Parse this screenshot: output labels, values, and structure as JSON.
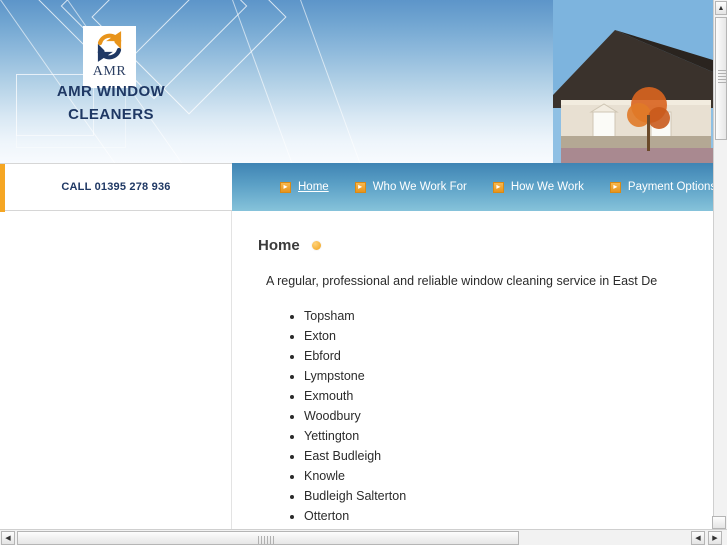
{
  "header": {
    "logo_word": "AMR",
    "brand_line1": "AMR WINDOW",
    "brand_line2": "CLEANERS",
    "logo_icon": "recycle-arrows-icon",
    "photo_alt": "house-photo"
  },
  "contact": {
    "call_text": "CALL 01395 278 936"
  },
  "nav": {
    "items": [
      {
        "label": "Home",
        "active": true
      },
      {
        "label": "Who We Work For",
        "active": false
      },
      {
        "label": "How We Work",
        "active": false
      },
      {
        "label": "Payment Options",
        "active": false
      },
      {
        "label": "",
        "active": false
      }
    ],
    "arrow_glyph": "▸"
  },
  "main": {
    "title": "Home",
    "intro": "A regular, professional and reliable window cleaning service in East De",
    "places": [
      "Topsham",
      "Exton",
      "Ebford",
      "Lympstone",
      "Exmouth",
      "Woodbury",
      "Yettington",
      "East Budleigh",
      "Knowle",
      "Budleigh Salterton",
      "Otterton"
    ]
  },
  "scrollbars": {
    "up_arrow": "▲",
    "left_arrow": "◀",
    "right_arrow": "▶"
  },
  "colors": {
    "accent_orange": "#f5a623",
    "brand_blue": "#1f3864",
    "nav_blue": "#5ba0c6"
  }
}
